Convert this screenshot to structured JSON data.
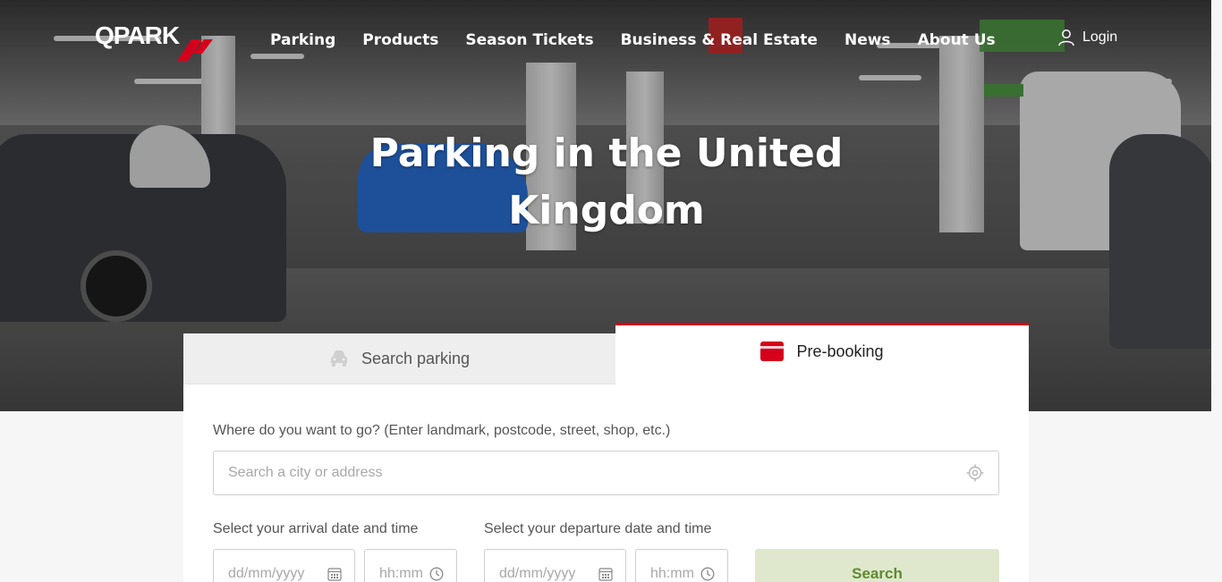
{
  "header": {
    "logo_text": "QPARK",
    "nav": [
      "Parking",
      "Products",
      "Season Tickets",
      "Business & Real Estate",
      "News",
      "About Us"
    ],
    "login_label": "Login"
  },
  "hero": {
    "title_line1": "Parking in the United",
    "title_line2": "Kingdom"
  },
  "tabs": {
    "search_parking": "Search parking",
    "pre_booking": "Pre-booking",
    "active": "Pre-booking"
  },
  "form": {
    "location_label": "Where do you want to go? (Enter landmark, postcode, street, shop, etc.)",
    "location_placeholder": "Search a city or address",
    "arrival_label": "Select your arrival date and time",
    "departure_label": "Select your departure date and time",
    "date_placeholder": "dd/mm/yyyy",
    "time_placeholder": "hh:mm",
    "search_label": "Search"
  },
  "icons": {
    "logo": "qpark-logo",
    "login": "user-icon",
    "search_tab": "car-icon",
    "prebook_tab": "credit-card-icon",
    "location": "crosshair-icon",
    "date": "calendar-icon",
    "time": "clock-icon"
  },
  "colors": {
    "brand_red": "#d5001c",
    "search_button_bg": "#dfe8cc",
    "search_button_text": "#5f8a2f"
  }
}
